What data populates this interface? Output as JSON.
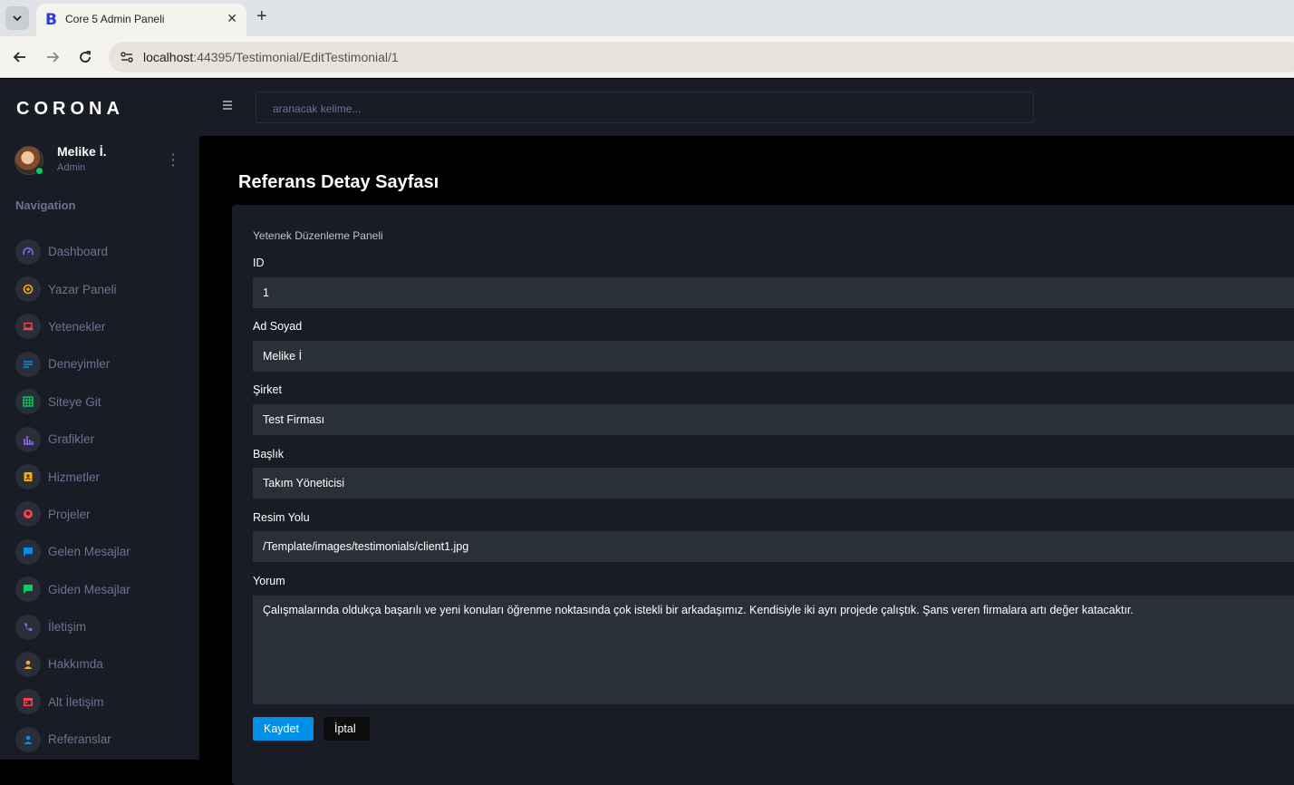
{
  "browser": {
    "tab_title": "Core 5 Admin Paneli",
    "url_host": "localhost",
    "url_rest": ":44395/Testimonial/EditTestimonial/1"
  },
  "sidebar": {
    "brand": "CORONA",
    "profile": {
      "name": "Melike İ.",
      "role": "Admin"
    },
    "nav_heading": "Navigation",
    "items": [
      {
        "label": "Dashboard",
        "icon": "speedometer-icon",
        "color": "#8f5fe8"
      },
      {
        "label": "Yazar Paneli",
        "icon": "playlist-icon",
        "color": "#ffab00"
      },
      {
        "label": "Yetenekler",
        "icon": "laptop-icon",
        "color": "#fc424a"
      },
      {
        "label": "Deneyimler",
        "icon": "list-icon",
        "color": "#0090e7"
      },
      {
        "label": "Siteye Git",
        "icon": "table-icon",
        "color": "#00d25b"
      },
      {
        "label": "Grafikler",
        "icon": "chart-icon",
        "color": "#8f5fe8"
      },
      {
        "label": "Hizmetler",
        "icon": "contacts-icon",
        "color": "#ffab00"
      },
      {
        "label": "Projeler",
        "icon": "github-icon",
        "color": "#fc424a"
      },
      {
        "label": "Gelen Mesajlar",
        "icon": "message-icon",
        "color": "#0090e7"
      },
      {
        "label": "Giden Mesajlar",
        "icon": "message-icon",
        "color": "#00d25b"
      },
      {
        "label": "İletişim",
        "icon": "phone-icon",
        "color": "#8f5fe8"
      },
      {
        "label": "Hakkımda",
        "icon": "account-icon",
        "color": "#ffab00"
      },
      {
        "label": "Alt İletişim",
        "icon": "calendar-icon",
        "color": "#fc424a"
      },
      {
        "label": "Referanslar",
        "icon": "account-icon",
        "color": "#0090e7"
      }
    ]
  },
  "topbar": {
    "search_placeholder": "aranacak kelime..."
  },
  "page": {
    "title": "Referans Detay Sayfası",
    "card_title": "Yetenek Düzenleme Paneli",
    "fields": {
      "id": {
        "label": "ID",
        "value": "1"
      },
      "name": {
        "label": "Ad Soyad",
        "value": "Melike İ"
      },
      "company": {
        "label": "Şirket",
        "value": "Test Firması"
      },
      "title": {
        "label": "Başlık",
        "value": "Takım Yöneticisi"
      },
      "image": {
        "label": "Resim Yolu",
        "value": "/Template/images/testimonials/client1.jpg"
      },
      "comment": {
        "label": "Yorum",
        "value": "Çalışmalarında oldukça başarılı ve yeni konuları öğrenme noktasında çok istekli bir arkadaşımız. Kendisiyle iki ayrı projede çalıştık. Şans veren firmalara artı değer katacaktır."
      }
    },
    "save_label": "Kaydet",
    "cancel_label": "İptal"
  }
}
